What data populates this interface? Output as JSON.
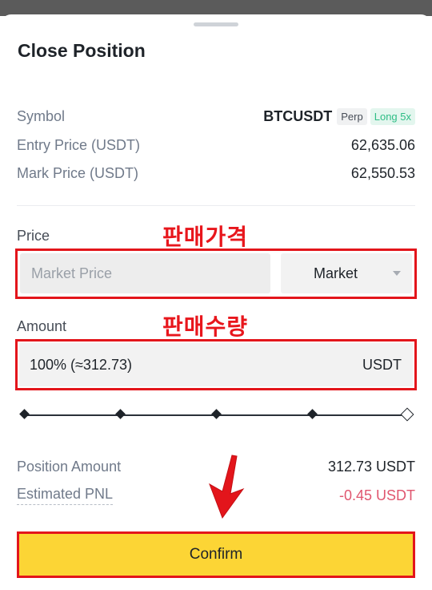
{
  "sheet": {
    "title": "Close Position"
  },
  "info": {
    "symbol_label": "Symbol",
    "symbol_value": "BTCUSDT",
    "tag_perp": "Perp",
    "tag_long": "Long 5x",
    "entry_label": "Entry Price (USDT)",
    "entry_value": "62,635.06",
    "mark_label": "Mark Price (USDT)",
    "mark_value": "62,550.53"
  },
  "price": {
    "label": "Price",
    "annotation": "판매가격",
    "placeholder": "Market Price",
    "type_value": "Market"
  },
  "amount": {
    "label": "Amount",
    "annotation": "판매수량",
    "value": "100% (≈312.73)",
    "unit": "USDT",
    "slider_percent": 100
  },
  "summary": {
    "position_label": "Position Amount",
    "position_value": "312.73 USDT",
    "pnl_label": "Estimated PNL",
    "pnl_value": "-0.45 USDT"
  },
  "confirm_label": "Confirm",
  "colors": {
    "accent": "#fcd535",
    "annotation_red": "#e3151b",
    "long_green": "#2ebd85",
    "negative": "#e0566f"
  }
}
